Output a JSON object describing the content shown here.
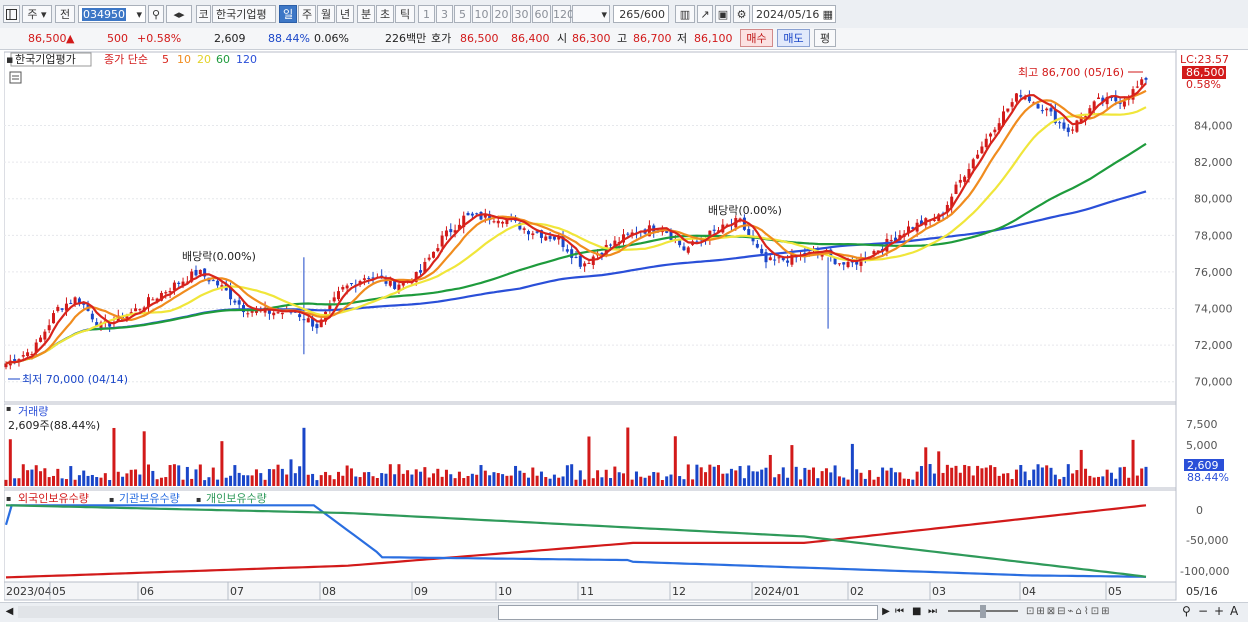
{
  "toolbar": {
    "market_label": "주",
    "prev_label": "전",
    "code": "034950",
    "code_badge": "코",
    "name": "한국기업평",
    "periods": [
      "일",
      "주",
      "월",
      "년",
      "분",
      "초",
      "틱"
    ],
    "active_period": "일",
    "intervals": [
      "1",
      "3",
      "5",
      "10",
      "20",
      "30",
      "60",
      "120"
    ],
    "count": "265",
    "count_total": "/600",
    "date": "2024/05/16"
  },
  "quote": {
    "price": "86,500",
    "arrow": "▲",
    "change": "500",
    "change_pct": "+0.58%",
    "volume": "2,609",
    "volume_ratio": "88.44%",
    "turnover_pct": "0.06%",
    "amount": "226백만",
    "hoga_label": "호가",
    "ask": "86,500",
    "bid": "86,400",
    "open_label": "시",
    "open": "86,300",
    "high_label": "고",
    "high": "86,700",
    "low_label": "저",
    "low": "86,100",
    "buy_label": "매수",
    "sell_label": "매도",
    "eval_label": "평"
  },
  "price_panel": {
    "legend_name": "한국기업평가",
    "legend_type": "종가 단순",
    "ma_labels": [
      "5",
      "10",
      "20",
      "60",
      "120"
    ],
    "lc_label": "LC:23.57",
    "last_price": "86,500",
    "last_pct": "0.58%",
    "high_note": "최고 86,700 (05/16)",
    "low_note": "최저 70,000 (04/14)",
    "div_notes": [
      "배당락(0.00%)",
      "배당락(0.00%)"
    ]
  },
  "volume_panel": {
    "title": "거래량",
    "value_note": "2,609주(88.44%)",
    "last_value": "2,609",
    "last_pct": "88.44%"
  },
  "holdings_panel": {
    "legends": [
      "외국인보유수량",
      "기관보유수량",
      "개인보유수량"
    ]
  },
  "colors": {
    "ma5": "#d8241c",
    "ma10": "#f08c1e",
    "ma20": "#f0e63a",
    "ma60": "#1e9b3c",
    "ma120": "#2a4fd8",
    "up": "#d21a1a",
    "down": "#1a46c8",
    "foreign": "#d21a1a",
    "institution": "#2a6ee0",
    "individual": "#2f9a5a"
  },
  "chart_data": {
    "type": "candlestick",
    "period": "daily",
    "x_labels": [
      "2023/04",
      "05",
      "06",
      "07",
      "08",
      "09",
      "10",
      "11",
      "12",
      "2024/01",
      "02",
      "03",
      "04",
      "05",
      "05/16"
    ],
    "price_axis": [
      "84,000",
      "82,000",
      "80,000",
      "78,000",
      "76,000",
      "74,000",
      "72,000",
      "70,000"
    ],
    "price_ylim": [
      69000,
      87800
    ],
    "price_close_anchors": [
      {
        "x": "2023/04/14",
        "close": 71000
      },
      {
        "x": "2023/04/24",
        "close": 71800
      },
      {
        "x": "2023/05/02",
        "close": 74000
      },
      {
        "x": "2023/05/09",
        "close": 74600
      },
      {
        "x": "2023/05/17",
        "close": 73000
      },
      {
        "x": "2023/05/25",
        "close": 73500
      },
      {
        "x": "2023/06/02",
        "close": 74300
      },
      {
        "x": "2023/06/12",
        "close": 75300
      },
      {
        "x": "2023/06/20",
        "close": 76000
      },
      {
        "x": "2023/06/28",
        "close": 75200
      },
      {
        "x": "2023/07/06",
        "close": 74000
      },
      {
        "x": "2023/07/14",
        "close": 73800
      },
      {
        "x": "2023/07/24",
        "close": 73800
      },
      {
        "x": "2023/08/01",
        "close": 73000
      },
      {
        "x": "2023/08/09",
        "close": 75000
      },
      {
        "x": "2023/08/18",
        "close": 75800
      },
      {
        "x": "2023/08/28",
        "close": 75300
      },
      {
        "x": "2023/09/05",
        "close": 75800
      },
      {
        "x": "2023/09/13",
        "close": 77800
      },
      {
        "x": "2023/09/21",
        "close": 79000
      },
      {
        "x": "2023/10/04",
        "close": 79000
      },
      {
        "x": "2023/10/13",
        "close": 78300
      },
      {
        "x": "2023/10/24",
        "close": 77800
      },
      {
        "x": "2023/11/01",
        "close": 76400
      },
      {
        "x": "2023/11/09",
        "close": 77300
      },
      {
        "x": "2023/11/20",
        "close": 78200
      },
      {
        "x": "2023/11/29",
        "close": 78500
      },
      {
        "x": "2023/12/07",
        "close": 77200
      },
      {
        "x": "2023/12/15",
        "close": 78000
      },
      {
        "x": "2023/12/26",
        "close": 78800
      },
      {
        "x": "2024/01/04",
        "close": 76500
      },
      {
        "x": "2024/01/15",
        "close": 76800
      },
      {
        "x": "2024/01/24",
        "close": 77000
      },
      {
        "x": "2024/02/02",
        "close": 76300
      },
      {
        "x": "2024/02/14",
        "close": 77400
      },
      {
        "x": "2024/02/23",
        "close": 78400
      },
      {
        "x": "2024/03/05",
        "close": 79000
      },
      {
        "x": "2024/03/14",
        "close": 81500
      },
      {
        "x": "2024/03/25",
        "close": 84200
      },
      {
        "x": "2024/04/02",
        "close": 85800
      },
      {
        "x": "2024/04/10",
        "close": 85000
      },
      {
        "x": "2024/04/19",
        "close": 83700
      },
      {
        "x": "2024/04/29",
        "close": 85300
      },
      {
        "x": "2024/05/08",
        "close": 85400
      },
      {
        "x": "2024/05/16",
        "close": 86500
      }
    ],
    "ma_endpoints": {
      "ma5": 86300,
      "ma10": 85900,
      "ma20": 85000,
      "ma60": 83000,
      "ma120": 80400
    },
    "notable_lows": [
      {
        "x": "2024/01/26",
        "low": 72900
      },
      {
        "x": "2023/07/27",
        "low": 71500
      }
    ],
    "volume_axis": [
      "7,500",
      "5,000"
    ],
    "volume_last": 2609,
    "holdings_axis": [
      "0",
      "-50,000",
      "-100,000"
    ],
    "holdings_series": [
      {
        "name": "외국인보유수량",
        "start": -101000,
        "end": 10000
      },
      {
        "name": "기관보유수량",
        "start": -20000,
        "end": -100000
      },
      {
        "name": "개인보유수량",
        "start": 10000,
        "end": -100000
      }
    ]
  }
}
